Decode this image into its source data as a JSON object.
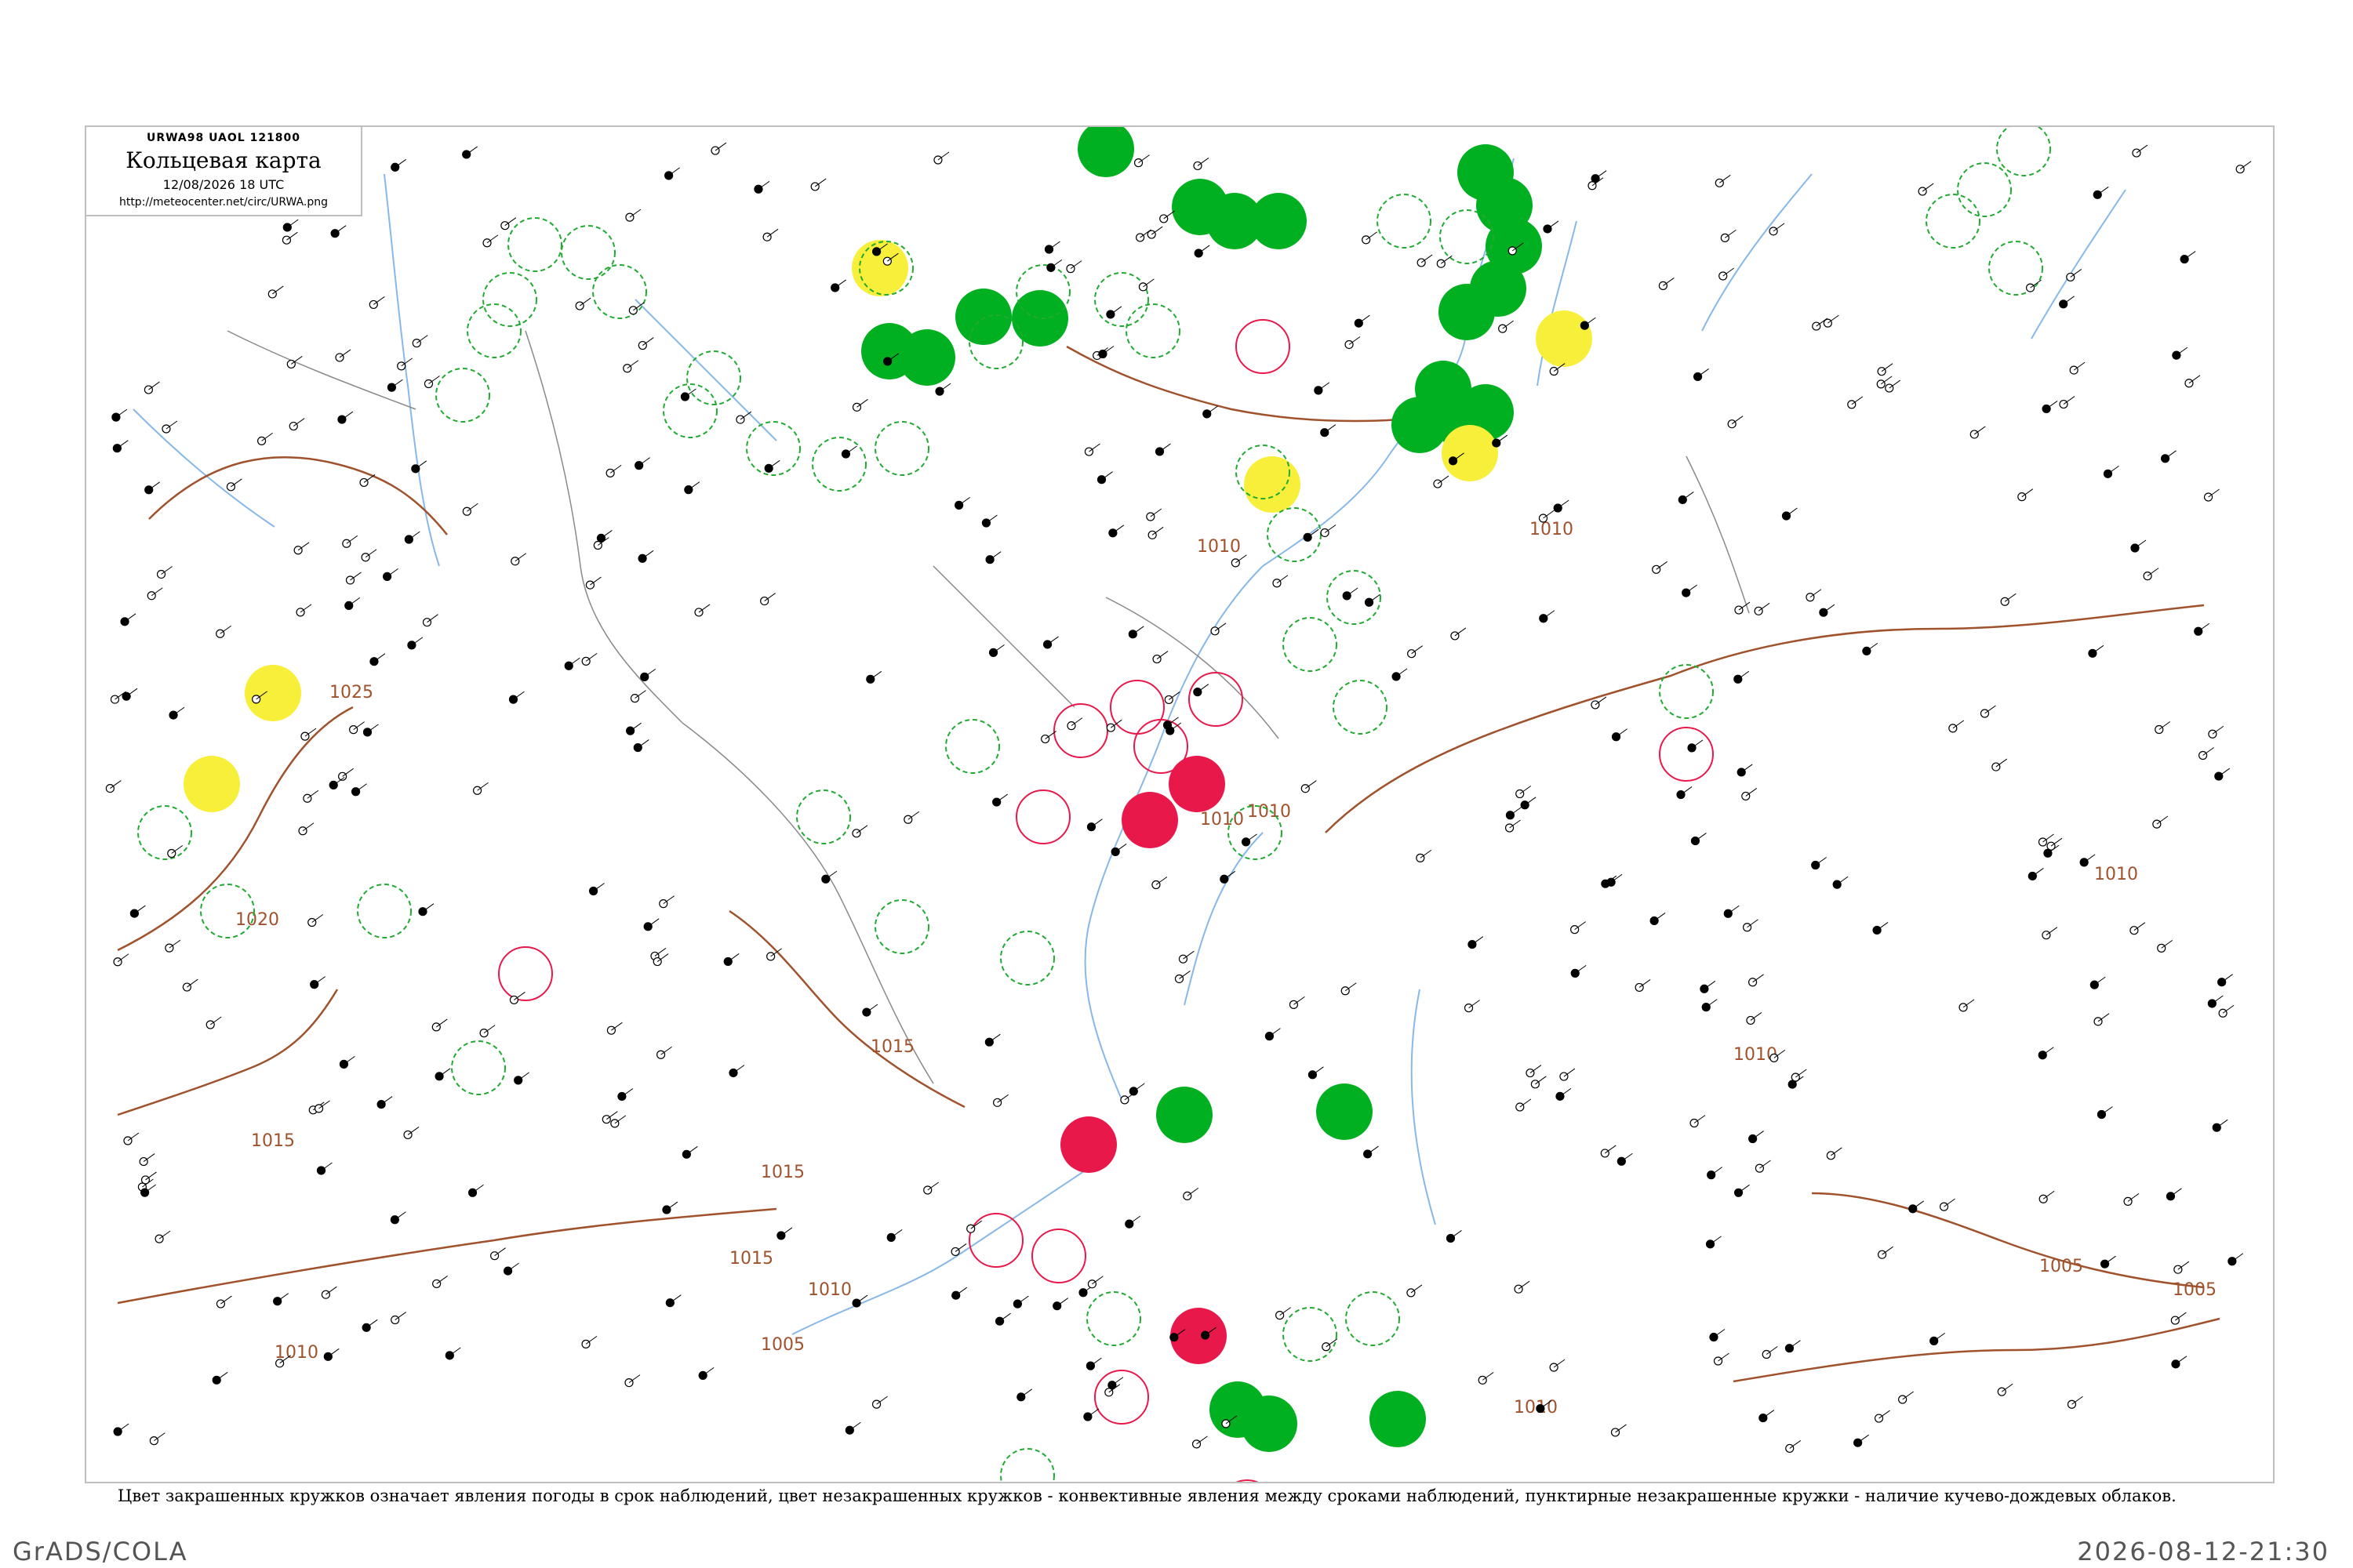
{
  "header": {
    "code": "URWA98 UAOL 121800",
    "title": "Кольцевая карта",
    "time": "12/08/2026 18 UTC",
    "url": "http://meteocenter.net/circ/URWA.png"
  },
  "caption": "Цвет закрашенных кружков означает явления погоды в срок наблюдений, цвет незакрашенных кружков - конвективные явления между сроками наблюдений, пунктирные незакрашенные кружки - наличие кучево-дождевых облаков.",
  "footer": {
    "left": "GrADS/COLA",
    "right": "2026-08-12-21:30"
  },
  "colors": {
    "rain": "#00b020",
    "thunder": "#e8194a",
    "fog_haze": "#f7ef3a",
    "cb_ring": "#22aa33",
    "isobar": "#a0522d",
    "river": "#88b8e8",
    "frame": "#bfbfbf"
  },
  "isobars": [
    {
      "label": "1025"
    },
    {
      "label": "1020"
    },
    {
      "label": "1015"
    },
    {
      "label": "1010"
    },
    {
      "label": "1005"
    }
  ]
}
